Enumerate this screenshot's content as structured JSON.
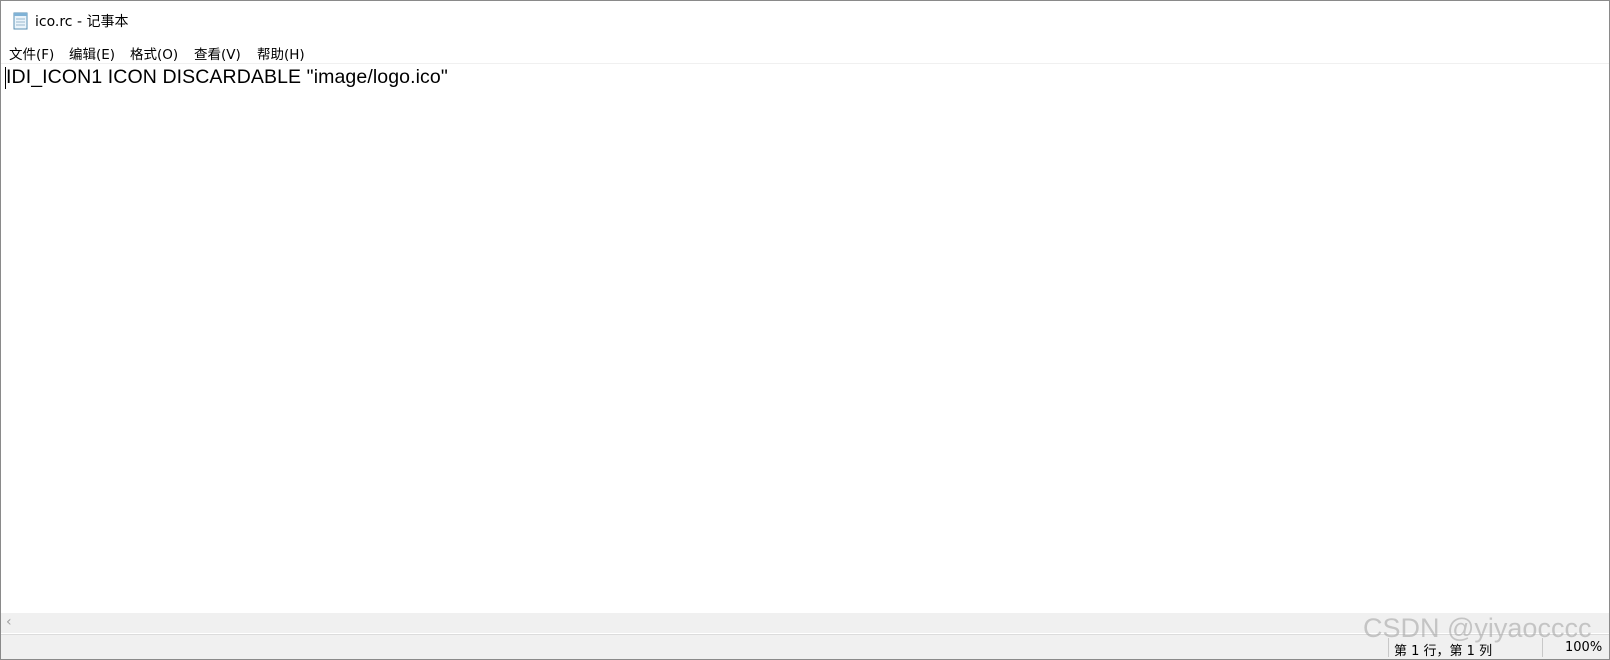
{
  "window": {
    "title": "ico.rc - 记事本",
    "app_icon": "notepad-icon"
  },
  "menu": {
    "items": [
      {
        "label": "文件(F)"
      },
      {
        "label": "编辑(E)"
      },
      {
        "label": "格式(O)"
      },
      {
        "label": "查看(V)"
      },
      {
        "label": "帮助(H)"
      }
    ]
  },
  "editor": {
    "content": "IDI_ICON1 ICON DISCARDABLE \"image/logo.ico\""
  },
  "scrollbar": {
    "left_arrow_icon": "chevron-left-icon"
  },
  "status": {
    "position": "第 1 行，第 1 列",
    "zoom": "100%"
  },
  "watermark": {
    "text": "CSDN @yiyaocccc"
  }
}
